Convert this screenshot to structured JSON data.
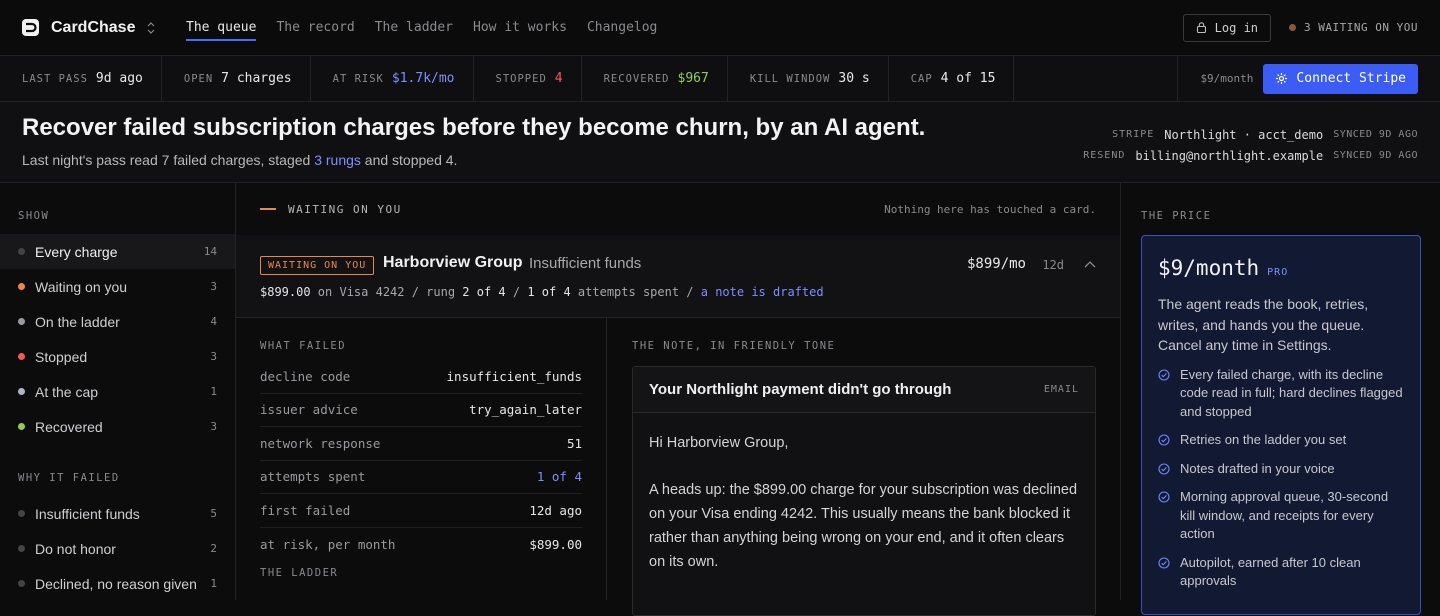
{
  "brand": {
    "name": "CardChase"
  },
  "nav": {
    "tabs": [
      {
        "label": "The queue"
      },
      {
        "label": "The record"
      },
      {
        "label": "The ladder"
      },
      {
        "label": "How it works"
      },
      {
        "label": "Changelog"
      }
    ],
    "login_label": "Log in",
    "waiting_label": "3 WAITING ON YOU"
  },
  "stats": [
    {
      "key": "LAST PASS",
      "value": "9d ago",
      "color": "#e8e8ea"
    },
    {
      "key": "OPEN",
      "value": "7 charges",
      "color": "#e8e8ea"
    },
    {
      "key": "AT RISK",
      "value": "$1.7k/mo",
      "color": "#7b90ff"
    },
    {
      "key": "STOPPED",
      "value": "4",
      "color": "#f05a5a"
    },
    {
      "key": "RECOVERED",
      "value": "$967",
      "color": "#8fd14f"
    },
    {
      "key": "KILL WINDOW",
      "value": "30 s",
      "color": "#e8e8ea"
    },
    {
      "key": "CAP",
      "value": "4 of 15",
      "color": "#e8e8ea"
    }
  ],
  "stats_right": {
    "price": "$9/month",
    "connect_label": "Connect Stripe"
  },
  "hero": {
    "title": "Recover failed subscription charges before they become churn, by an AI agent.",
    "sub_before": "Last night's pass read 7 failed charges, staged ",
    "sub_link": "3 rungs",
    "sub_after": " and stopped 4.",
    "meta": [
      {
        "label": "STRIPE",
        "value": "Northlight · acct_demo",
        "synced": "SYNCED 9D AGO"
      },
      {
        "label": "RESEND",
        "value": "billing@northlight.example",
        "synced": "SYNCED 9D AGO"
      }
    ]
  },
  "sidebar": {
    "show_title": "SHOW",
    "show_items": [
      {
        "label": "Every charge",
        "count": "14",
        "color": "#444448"
      },
      {
        "label": "Waiting on you",
        "count": "3",
        "color": "#e8894a"
      },
      {
        "label": "On the ladder",
        "count": "4",
        "color": "#9a9aa0"
      },
      {
        "label": "Stopped",
        "count": "3",
        "color": "#f05a5a"
      },
      {
        "label": "At the cap",
        "count": "1",
        "color": "#b0b4c8"
      },
      {
        "label": "Recovered",
        "count": "3",
        "color": "#8fd14f"
      }
    ],
    "why_title": "WHY IT FAILED",
    "why_items": [
      {
        "label": "Insufficient funds",
        "count": "5",
        "color": "#444448"
      },
      {
        "label": "Do not honor",
        "count": "2",
        "color": "#444448"
      },
      {
        "label": "Declined, no reason given",
        "count": "1",
        "color": "#444448"
      }
    ]
  },
  "main": {
    "section_title": "WAITING ON YOU",
    "section_note": "Nothing here has touched a card.",
    "card": {
      "badge": "WAITING ON YOU",
      "customer": "Harborview Group",
      "reason": "Insufficient funds",
      "amount": "$899/mo",
      "age": "12d",
      "line_amount": "$899.00",
      "line_card": " on Visa 4242 / rung ",
      "line_rung": "2 of 4",
      "line_mid": " / ",
      "line_attempts": "1 of 4",
      "line_att_text": " attempts spent / ",
      "line_note": "a note is drafted"
    },
    "what_failed_title": "WHAT FAILED",
    "what_failed": [
      {
        "k": "decline code",
        "v": "insufficient_funds"
      },
      {
        "k": "issuer advice",
        "v": "try_again_later"
      },
      {
        "k": "network response",
        "v": "51"
      },
      {
        "k": "attempts spent",
        "v": "1 of 4"
      },
      {
        "k": "first failed",
        "v": "12d ago"
      },
      {
        "k": "at risk, per month",
        "v": "$899.00"
      }
    ],
    "ladder_title": "THE LADDER",
    "note_title": "THE NOTE, IN FRIENDLY TONE",
    "note": {
      "subject": "Your Northlight payment didn't go through",
      "channel": "EMAIL",
      "greeting": "Hi Harborview Group,",
      "body": "A heads up: the $899.00 charge for your subscription was declined on your Visa ending 4242. This usually means the bank blocked it rather than anything being wrong on your end, and it often clears on its own."
    }
  },
  "price_panel": {
    "title": "THE PRICE",
    "price": "$9/month",
    "tier": "PRO",
    "desc": "The agent reads the book, retries, writes, and hands you the queue. Cancel any time in Settings.",
    "features": [
      "Every failed charge, with its decline code read in full; hard declines flagged and stopped",
      "Retries on the ladder you set",
      "Notes drafted in your voice",
      "Morning approval queue, 30-second kill window, and receipts for every action",
      "Autopilot, earned after 10 clean approvals"
    ]
  }
}
